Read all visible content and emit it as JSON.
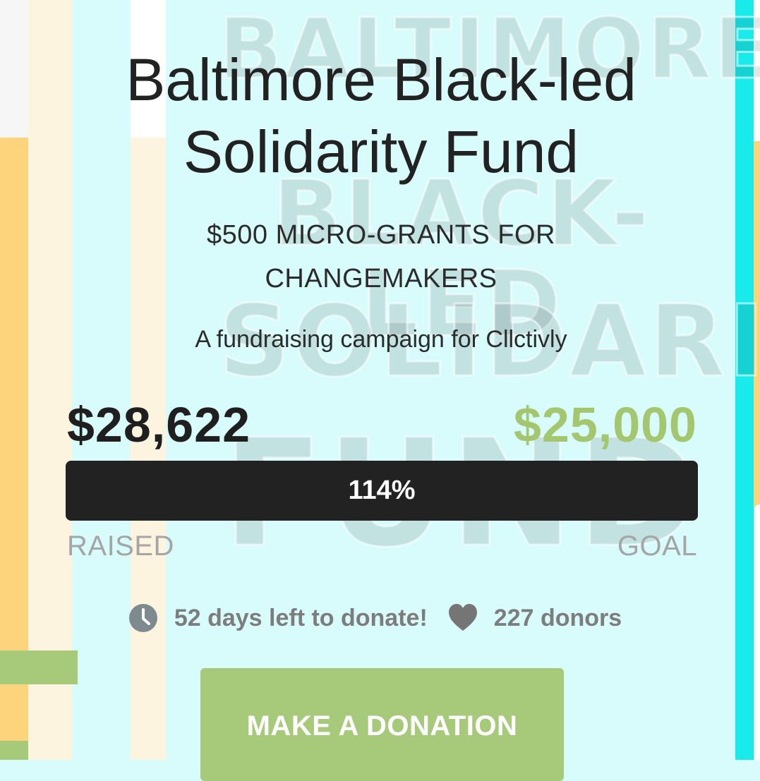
{
  "background_text": [
    "BALTIMORE",
    "BLACK-LED",
    "SOLIDARITY",
    "FUND"
  ],
  "campaign": {
    "title_line1": "Baltimore Black-led",
    "title_line2": "Solidarity Fund",
    "subtitle_line1": "$500 MICRO-GRANTS FOR",
    "subtitle_line2": "CHANGEMAKERS",
    "beneficiary_line": "A fundraising campaign for Cllctivly"
  },
  "funding": {
    "raised_amount": "$28,622",
    "goal_amount": "$25,000",
    "percent_label": "114%",
    "progress_fraction": 1.0,
    "raised_label": "RAISED",
    "goal_label": "GOAL"
  },
  "stats": {
    "days_left": "52 days left to donate!",
    "donors": "227 donors",
    "clock_icon": "clock-icon",
    "heart_icon": "heart-icon"
  },
  "cta": {
    "donate_label": "MAKE A DONATION"
  },
  "colors": {
    "accent_green": "#a6c97a",
    "goal_green": "#a3c66e",
    "progress_dark": "#222222",
    "muted_gray": "#a5a5a5",
    "background_cyan": "#d8fbfb"
  }
}
